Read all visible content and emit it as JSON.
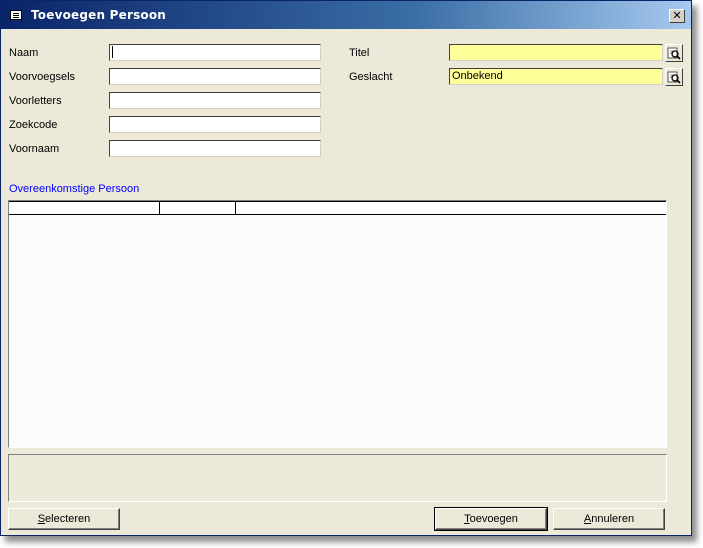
{
  "window": {
    "title": "Toevoegen Persoon"
  },
  "form": {
    "left_fields": [
      {
        "label": "Naam",
        "value": ""
      },
      {
        "label": "Voorvoegsels",
        "value": ""
      },
      {
        "label": "Voorletters",
        "value": ""
      },
      {
        "label": "Zoekcode",
        "value": ""
      },
      {
        "label": "Voornaam",
        "value": ""
      }
    ],
    "right_fields": [
      {
        "label": "Titel",
        "value": ""
      },
      {
        "label": "Geslacht",
        "value": "Onbekend"
      }
    ]
  },
  "matches": {
    "label": "Overeenkomstige Persoon",
    "columns": [
      "",
      "",
      ""
    ]
  },
  "buttons": {
    "select": {
      "mnemonic": "S",
      "rest": "electeren"
    },
    "add": {
      "mnemonic": "T",
      "rest": "oevoegen"
    },
    "cancel": {
      "mnemonic": "A",
      "rest": "nnuleren"
    }
  },
  "icons": {
    "window": "form-icon",
    "close": "close-icon",
    "lookup": "magnifier-icon"
  },
  "colors": {
    "title_start": "#0a246a",
    "lookup_field": "#ffff99",
    "section_label": "#0000ff"
  }
}
